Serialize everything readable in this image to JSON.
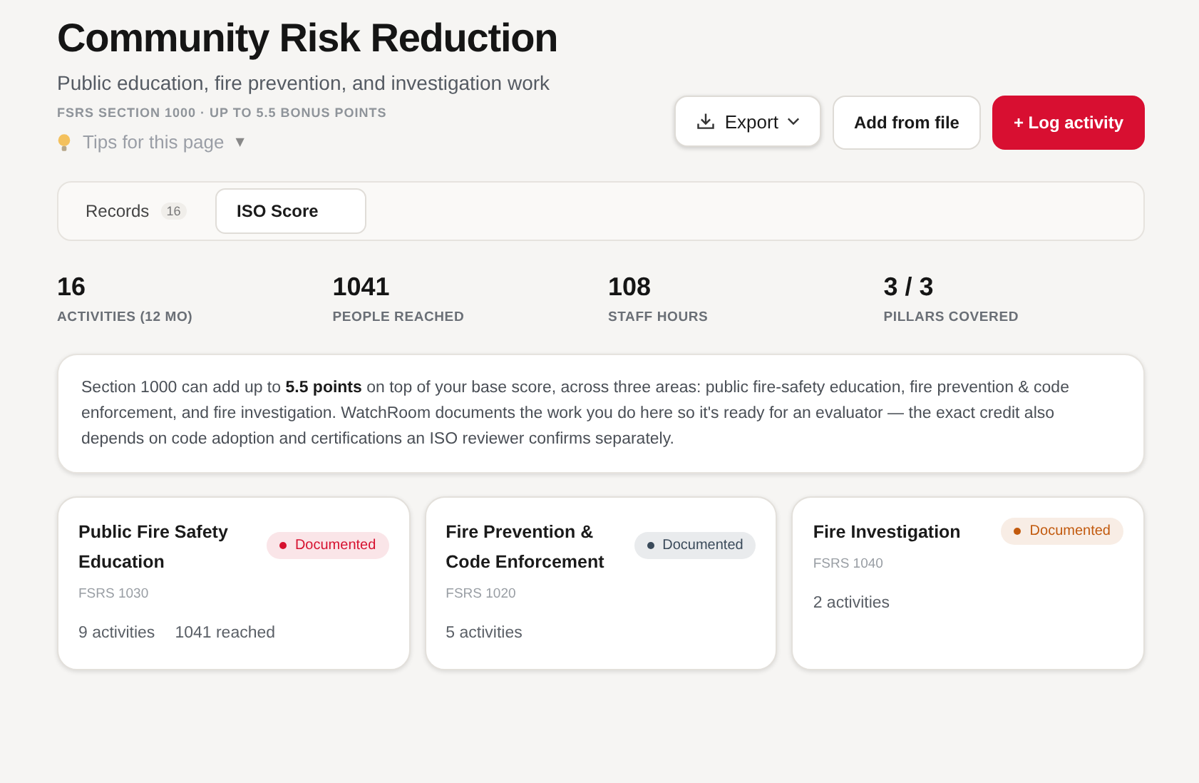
{
  "header": {
    "title": "Community Risk Reduction",
    "subtitle": "Public education, fire prevention, and investigation work",
    "eyebrow": "FSRS SECTION 1000 · UP TO 5.5 BONUS POINTS",
    "tips": {
      "label": "Tips for this page",
      "caret": "▼"
    }
  },
  "actions": [
    {
      "kind": "menu",
      "label": "Export"
    },
    {
      "kind": "secondary",
      "label": "Add from file"
    },
    {
      "kind": "primary",
      "label": "+ Log activity"
    }
  ],
  "tabs": [
    {
      "label": "Records",
      "count": "16",
      "selected": false
    },
    {
      "label": "ISO Score",
      "selected": true
    }
  ],
  "stats": [
    {
      "value": "16",
      "label": "ACTIVITIES (12 MO)"
    },
    {
      "value": "1041",
      "label": "PEOPLE REACHED"
    },
    {
      "value": "108",
      "label": "STAFF HOURS"
    },
    {
      "value": "3 / 3",
      "label": "PILLARS COVERED"
    }
  ],
  "info": "Section 1000 can add up to **5.5 points** on top of your base score, across three areas: public fire-safety education, fire prevention & code enforcement, and fire investigation. WatchRoom documents the work you do here so it's ready for an evaluator — the exact credit also depends on code adoption and certifications an ISO reviewer confirms separately.",
  "pillars": [
    {
      "title": "Public Fire Safety Education",
      "code": "FSRS 1030",
      "status": "Documented",
      "color": "#d6112f",
      "metrics": [
        "9 activities",
        "1041 reached"
      ]
    },
    {
      "title": "Fire Prevention & Code Enforcement",
      "code": "FSRS 1020",
      "status": "Documented",
      "color": "#3a4a5a",
      "metrics": [
        "5 activities"
      ]
    },
    {
      "title": "Fire Investigation",
      "code": "FSRS 1040",
      "status": "Documented",
      "color": "#c25a0e",
      "metrics": [
        "2 activities"
      ]
    }
  ]
}
